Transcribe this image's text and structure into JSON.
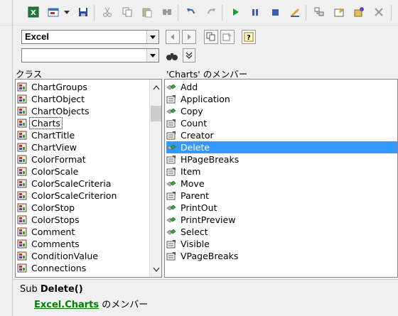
{
  "toolbar": {
    "icons": [
      "excel-icon",
      "form-icon",
      "dropdown-arrow-icon",
      "save-icon",
      "cut-icon",
      "copy-icon",
      "paste-icon",
      "find-icon",
      "undo-icon",
      "redo-icon",
      "run-icon",
      "pause-icon",
      "stop-icon",
      "design-mode-icon",
      "project-explorer-icon",
      "properties-icon",
      "object-browser-icon",
      "toolbox-icon"
    ]
  },
  "library_combo": {
    "value": "Excel"
  },
  "search_combo": {
    "value": ""
  },
  "class_header": "クラス",
  "members_header": "'Charts' のメンバー",
  "classes": [
    "ChartGroups",
    "ChartObject",
    "ChartObjects",
    "Charts",
    "ChartTitle",
    "ChartView",
    "ColorFormat",
    "ColorScale",
    "ColorScaleCriteria",
    "ColorScaleCriterion",
    "ColorStop",
    "ColorStops",
    "Comment",
    "Comments",
    "ConditionValue",
    "Connections"
  ],
  "selected_class": "Charts",
  "members": [
    {
      "name": "Add",
      "kind": "method"
    },
    {
      "name": "Application",
      "kind": "property"
    },
    {
      "name": "Copy",
      "kind": "method"
    },
    {
      "name": "Count",
      "kind": "property"
    },
    {
      "name": "Creator",
      "kind": "property"
    },
    {
      "name": "Delete",
      "kind": "method"
    },
    {
      "name": "HPageBreaks",
      "kind": "property"
    },
    {
      "name": "Item",
      "kind": "property"
    },
    {
      "name": "Move",
      "kind": "method"
    },
    {
      "name": "Parent",
      "kind": "property"
    },
    {
      "name": "PrintOut",
      "kind": "method"
    },
    {
      "name": "PrintPreview",
      "kind": "method"
    },
    {
      "name": "Select",
      "kind": "method"
    },
    {
      "name": "Visible",
      "kind": "property"
    },
    {
      "name": "VPageBreaks",
      "kind": "property"
    }
  ],
  "selected_member": "Delete",
  "detail": {
    "prefix": "Sub ",
    "name": "Delete()",
    "library_link": "Excel",
    "dot": ".",
    "class_link": "Charts",
    "suffix": " のメンバー"
  },
  "colors": {
    "selection": "#3399ff",
    "link": "#008000"
  }
}
